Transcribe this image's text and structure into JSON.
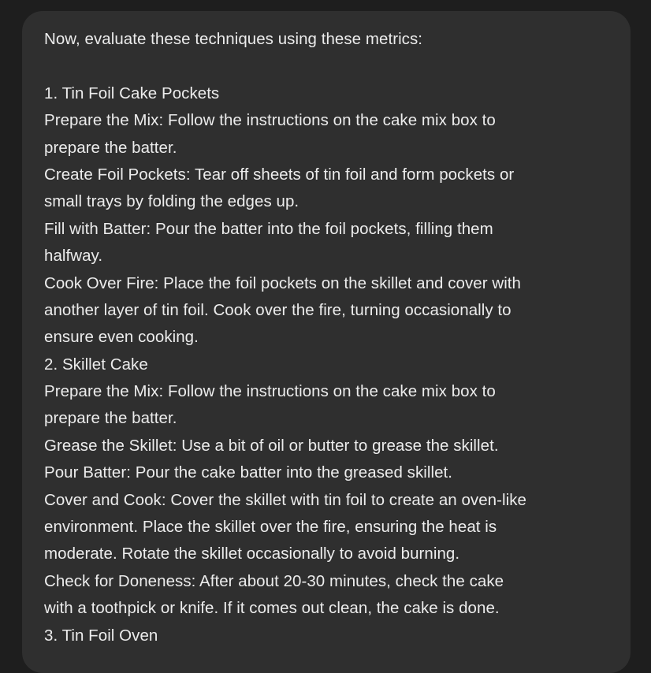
{
  "message": {
    "lines": [
      "Now, evaluate these techniques using these metrics:",
      "",
      "1. Tin Foil Cake Pockets",
      "Prepare the Mix: Follow the instructions on the cake mix box to",
      "prepare the batter.",
      "Create Foil Pockets: Tear off sheets of tin foil and form pockets or",
      "small trays by folding the edges up.",
      "Fill with Batter: Pour the batter into the foil pockets, filling them",
      "halfway.",
      "Cook Over Fire: Place the foil pockets on the skillet and cover with",
      "another layer of tin foil. Cook over the fire, turning occasionally to",
      "ensure even cooking.",
      "2. Skillet Cake",
      "Prepare the Mix: Follow the instructions on the cake mix box to",
      "prepare the batter.",
      "Grease the Skillet: Use a bit of oil or butter to grease the skillet.",
      "Pour Batter: Pour the cake batter into the greased skillet.",
      "Cover and Cook: Cover the skillet with tin foil to create an oven-like",
      "environment. Place the skillet over the fire, ensuring the heat is",
      "moderate. Rotate the skillet occasionally to avoid burning.",
      "Check for Doneness: After about 20-30 minutes, check the cake",
      "with a toothpick or knife. If it comes out clean, the cake is done.",
      "3. Tin Foil Oven"
    ]
  }
}
